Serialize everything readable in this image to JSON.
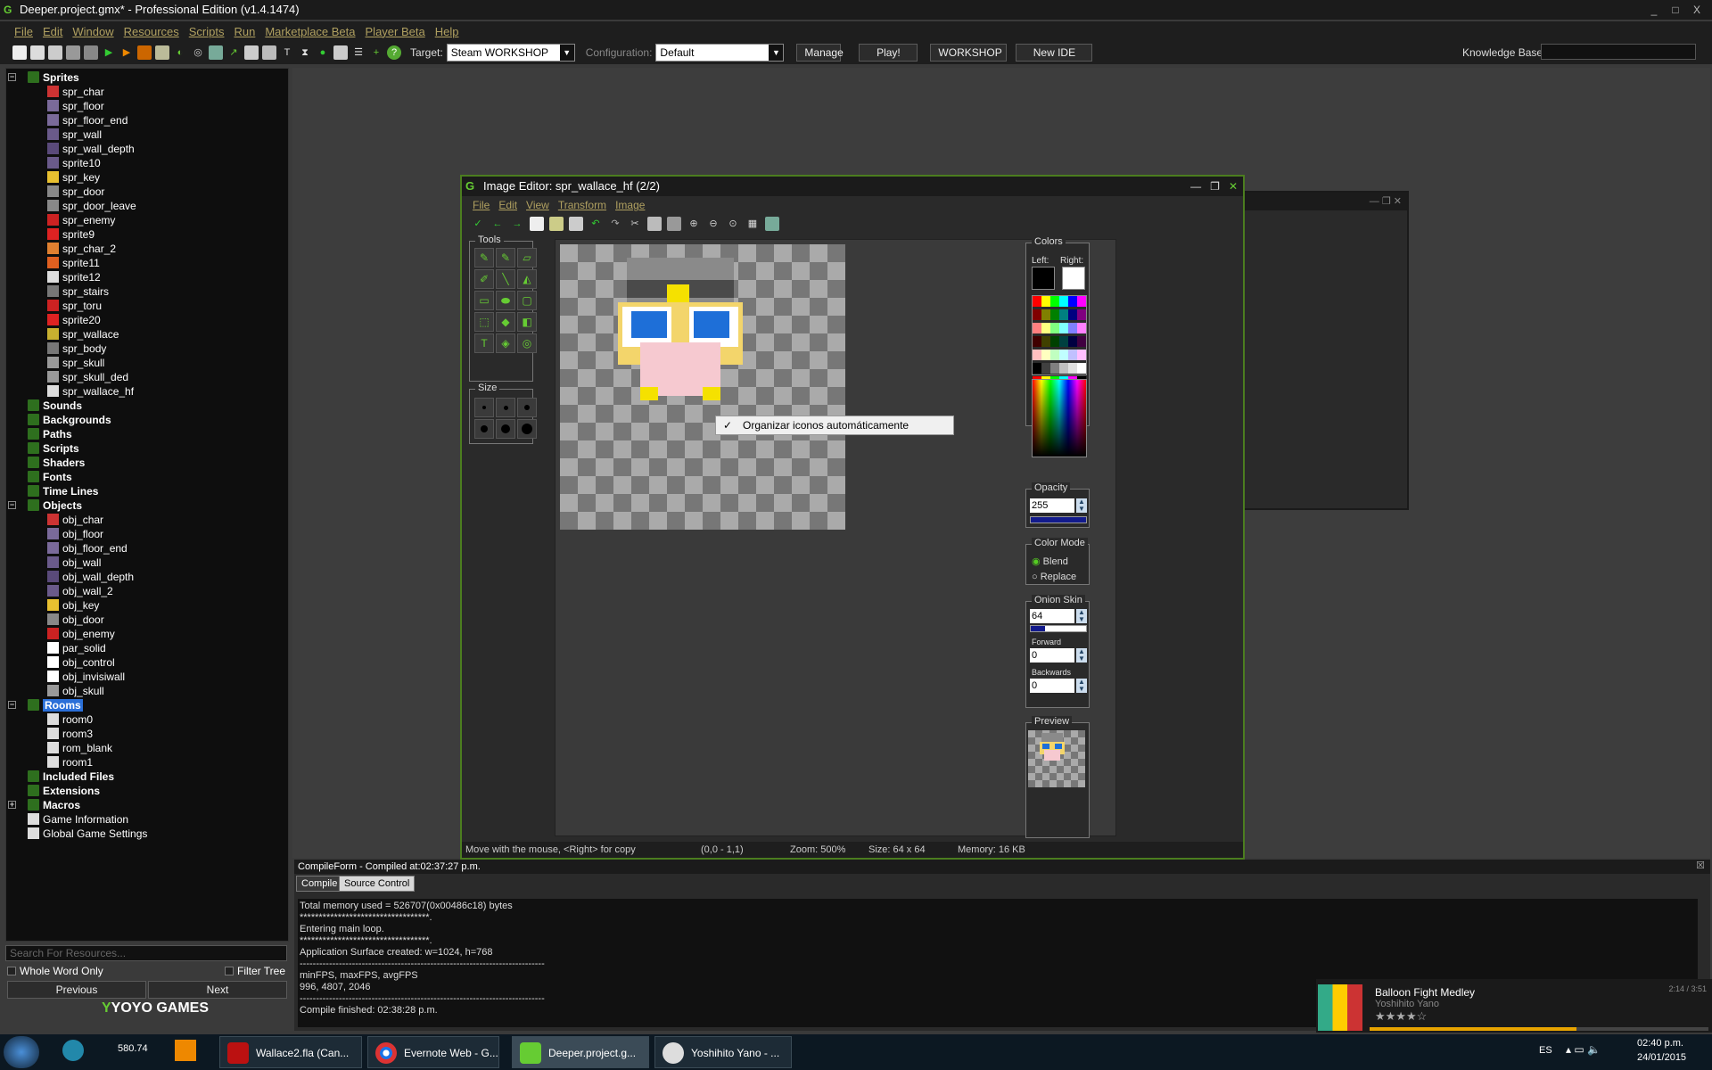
{
  "app": {
    "title": "Deeper.project.gmx* - Professional Edition (v1.4.1474)",
    "window_controls": [
      "_",
      "□",
      "X"
    ]
  },
  "menu": [
    "File",
    "Edit",
    "Window",
    "Resources",
    "Scripts",
    "Run",
    "Marketplace Beta",
    "Player Beta",
    "Help"
  ],
  "toolbar": {
    "target_label": "Target:",
    "target_value": "Steam WORKSHOP",
    "config_label": "Configuration:",
    "config_value": "Default",
    "manage": "Manage",
    "play": "Play!",
    "workshop": "WORKSHOP",
    "newide": "New IDE",
    "knowledge_label": "Knowledge Base:"
  },
  "tree": {
    "sprites_label": "Sprites",
    "sprites": [
      "spr_char",
      "spr_floor",
      "spr_floor_end",
      "spr_wall",
      "spr_wall_depth",
      "sprite10",
      "spr_key",
      "spr_door",
      "spr_door_leave",
      "spr_enemy",
      "sprite9",
      "spr_char_2",
      "sprite11",
      "sprite12",
      "spr_stairs",
      "spr_toru",
      "sprite20",
      "spr_wallace",
      "spr_body",
      "spr_skull",
      "spr_skull_ded",
      "spr_wallace_hf"
    ],
    "groups_mid": [
      "Sounds",
      "Backgrounds",
      "Paths",
      "Scripts",
      "Shaders",
      "Fonts",
      "Time Lines"
    ],
    "objects_label": "Objects",
    "objects": [
      "obj_char",
      "obj_floor",
      "obj_floor_end",
      "obj_wall",
      "obj_wall_depth",
      "obj_wall_2",
      "obj_key",
      "obj_door",
      "obj_enemy",
      "par_solid",
      "obj_control",
      "obj_invisiwall",
      "obj_skull"
    ],
    "rooms_label": "Rooms",
    "rooms": [
      "room0",
      "room3",
      "rom_blank",
      "room1"
    ],
    "groups_end": [
      "Included Files",
      "Extensions",
      "Macros"
    ],
    "info": [
      "Game Information",
      "Global Game Settings"
    ]
  },
  "search": {
    "placeholder": "Search For Resources...",
    "whole_word": "Whole Word Only",
    "filter_tree": "Filter Tree",
    "previous": "Previous",
    "next": "Next"
  },
  "logo": {
    "text": "YOYO GAMES"
  },
  "image_editor": {
    "title": "Image Editor: spr_wallace_hf (2/2)",
    "menu": [
      "File",
      "Edit",
      "View",
      "Transform",
      "Image"
    ],
    "tools_label": "Tools",
    "size_label": "Size",
    "colors_label": "Colors",
    "left_label": "Left:",
    "right_label": "Right:",
    "opacity_label": "Opacity",
    "opacity_value": "255",
    "color_mode_label": "Color Mode",
    "blend": "Blend",
    "replace": "Replace",
    "onion_label": "Onion Skin",
    "onion_value": "64",
    "forward_label": "Forward",
    "forward_value": "0",
    "backwards_label": "Backwards",
    "backwards_value": "0",
    "preview_label": "Preview",
    "context_menu_item": "Organizar iconos automáticamente",
    "status": {
      "hint": "Move with the mouse, <Right> for copy",
      "coords": "(0,0 - 1,1)",
      "zoom": "Zoom: 500%",
      "size": "Size: 64 x 64",
      "memory": "Memory: 16 KB"
    },
    "left_color": "#000000",
    "right_color": "#ffffff"
  },
  "compile": {
    "header": "CompileForm - Compiled at:02:37:27 p.m.",
    "tabs": [
      "Compile",
      "Source Control"
    ],
    "log": "Total memory used = 526707(0x00486c18) bytes\n**********************************.\nEntering main loop.\n**********************************.\nApplication Surface created: w=1024, h=768\n---------------------------------------------------------------------------\nminFPS, maxFPS, avgFPS\n996, 4807, 2046\n---------------------------------------------------------------------------\nCompile finished: 02:38:28 p.m."
  },
  "music": {
    "title": "Balloon Fight Medley",
    "artist": "Yoshihito Yano",
    "time": "2:14 / 3:51",
    "rating": "★★★★☆",
    "progress": 0.61
  },
  "taskbar": {
    "items": [
      "Wallace2.fla (Can...",
      "Evernote Web - G...",
      "Deeper.project.g...",
      "Yoshihito Yano - ..."
    ],
    "desktop_icon_label": "580.74",
    "lang": "ES",
    "time": "02:40 p.m.",
    "date": "24/01/2015"
  },
  "colors": {
    "accent": "#4b7d1f",
    "menu_text": "#b0a060",
    "folder": "#2e6f1e"
  }
}
